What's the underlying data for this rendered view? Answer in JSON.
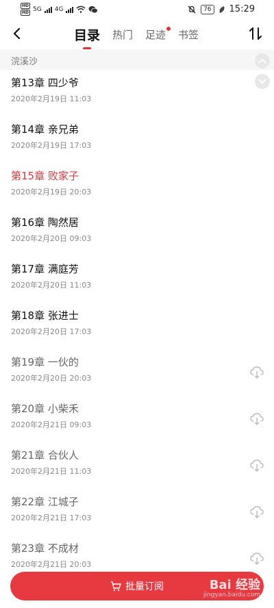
{
  "status_bar": {
    "left": [
      "HD",
      "HD",
      "5G",
      "4G"
    ],
    "battery": "76",
    "time": "15:29"
  },
  "header": {
    "tabs": [
      {
        "label": "目录",
        "active": true
      },
      {
        "label": "热门"
      },
      {
        "label": "足迹",
        "dot": true
      },
      {
        "label": "书签"
      }
    ]
  },
  "volume": "浣溪沙",
  "chapters": [
    {
      "title": "第13章 四少爷",
      "date": "2020年2月19日 11:03"
    },
    {
      "title": "第14章 亲兄弟",
      "date": "2020年2月19日 17:03"
    },
    {
      "title": "第15章 败家子",
      "date": "2020年2月19日 20:03"
    },
    {
      "title": "第16章 陶然居",
      "date": "2020年2月20日 09:03"
    },
    {
      "title": "第17章 满庭芳",
      "date": "2020年2月20日 11:03"
    },
    {
      "title": "第18章 张进士",
      "date": "2020年2月20日 17:03"
    },
    {
      "title": "第19章 一伙的",
      "date": "2020年2月20日 20:03"
    },
    {
      "title": "第20章 小柴禾",
      "date": "2020年2月21日 09:03"
    },
    {
      "title": "第21章 合伙人",
      "date": "2020年2月21日 11:03"
    },
    {
      "title": "第22章 江城子",
      "date": "2020年2月21日 17:03"
    },
    {
      "title": "第23章 不成材",
      "date": "2020年2月21日 20:03"
    }
  ],
  "bottom": {
    "label": "批量订阅"
  },
  "watermark": {
    "text": "Bai 经验",
    "sub": "jingyan.baidu.com"
  },
  "colors": {
    "accent": "#e63940",
    "current_chapter": "#d9393f"
  }
}
